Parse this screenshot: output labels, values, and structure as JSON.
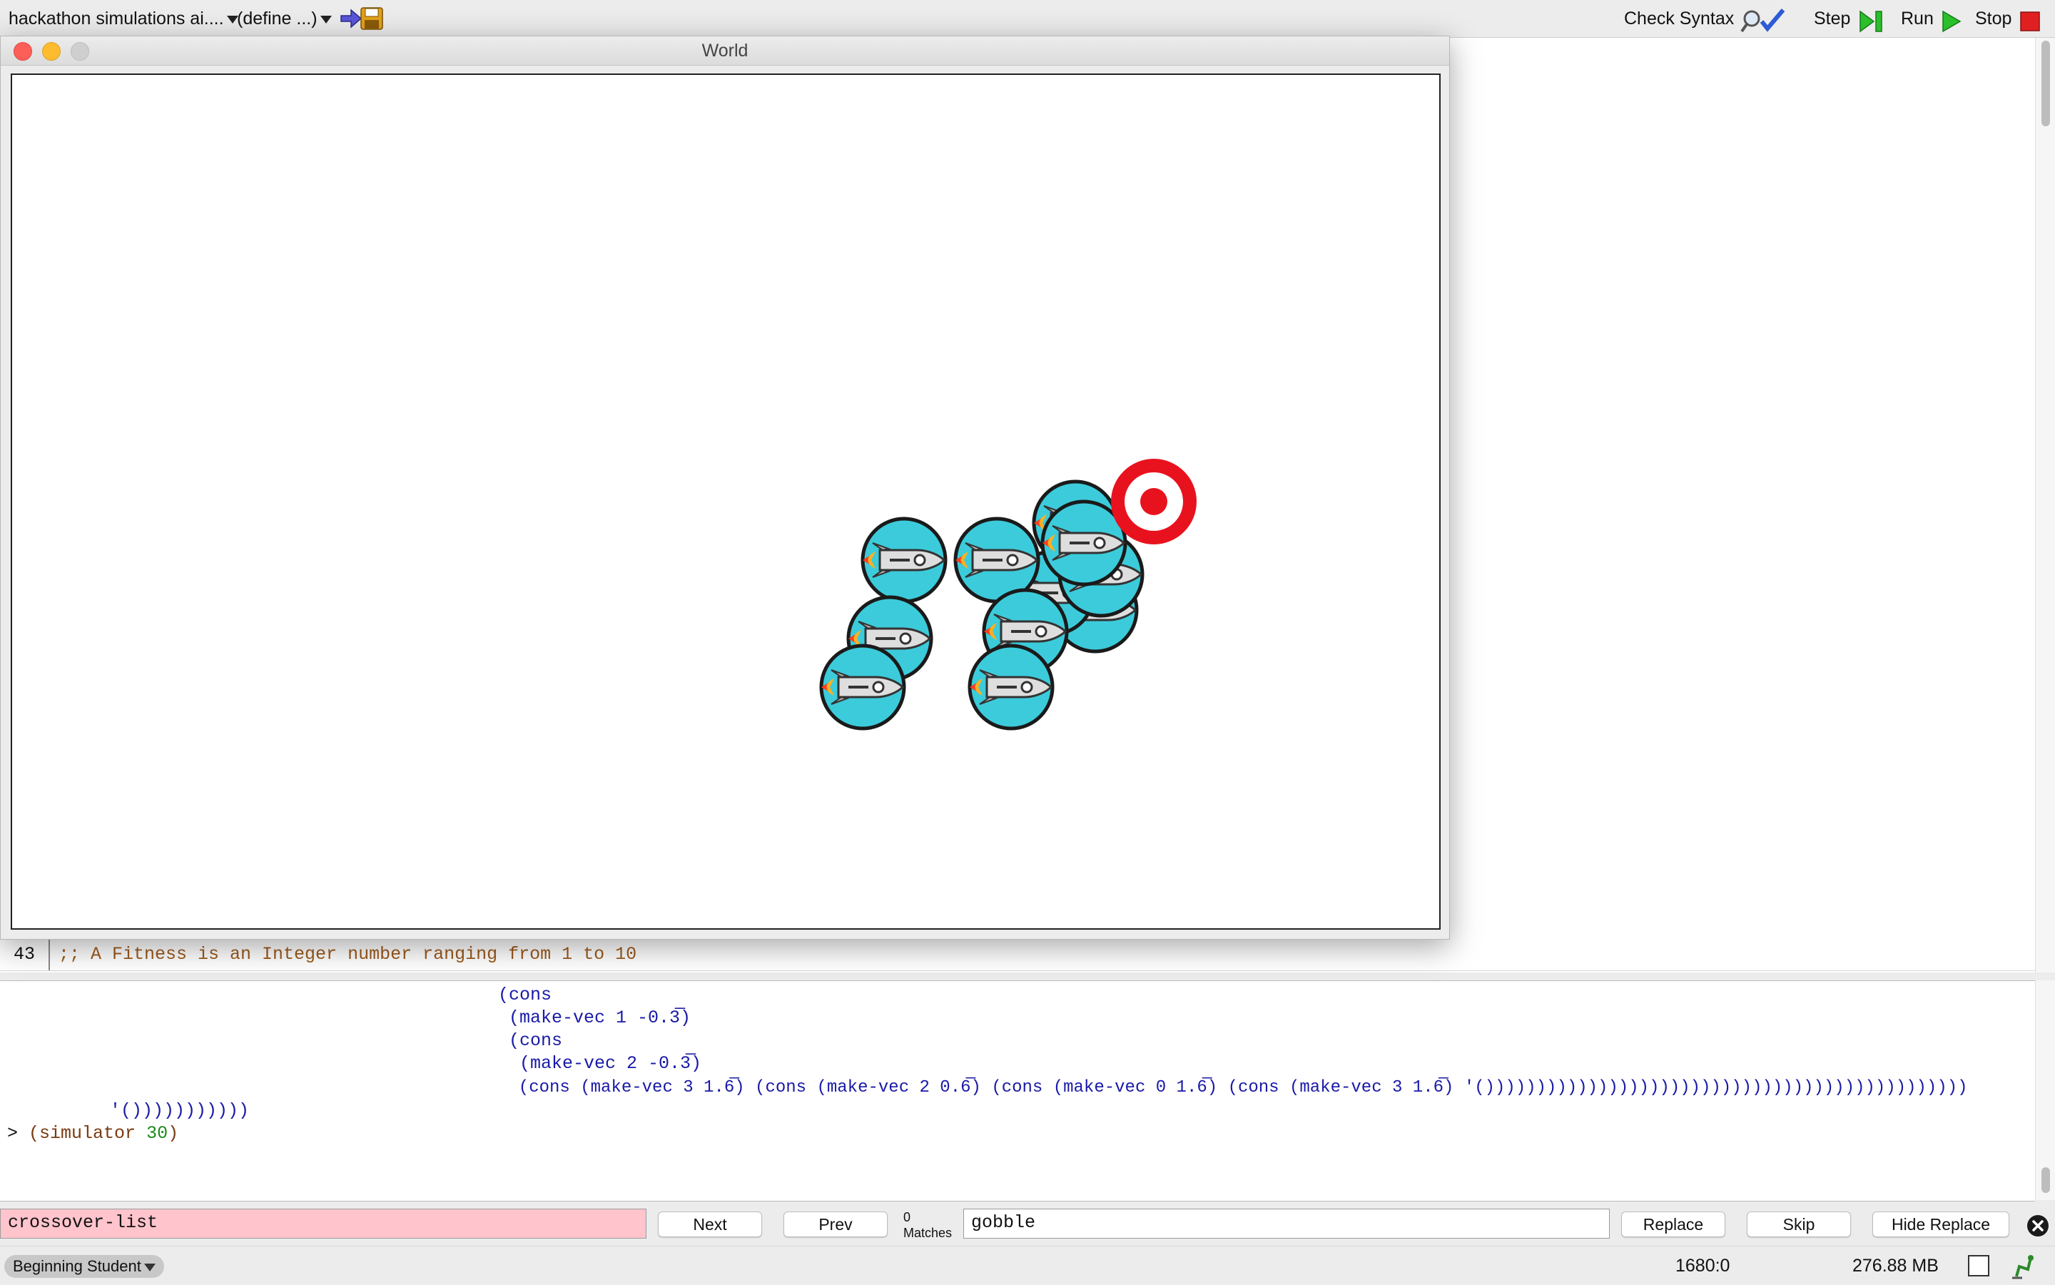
{
  "toolbar": {
    "file_name": "hackathon simulations ai....",
    "define_menu": "(define ...)",
    "check_syntax": "Check Syntax",
    "step": "Step",
    "run": "Run",
    "stop": "Stop"
  },
  "world_window": {
    "title": "World"
  },
  "editor": {
    "line_number": "43",
    "comment": ";; A Fitness is an Integer number ranging from 1 to 10"
  },
  "repl": {
    "lines": [
      "(cons",
      " (make-vec 1 -0.3̅)",
      " (cons",
      "  (make-vec 2 -0.3̅)",
      "  (cons (make-vec 3 1.6̅) (cons (make-vec 2 0.6̅) (cons (make-vec 0 1.6̅) (cons (make-vec 3 1.6̅) '()))))))))))))))))))))))))))))))))))))))))))))))",
      "'()))))))))))"
    ],
    "prompt": ">",
    "command_prefix": "(simulator ",
    "command_arg": "30",
    "command_suffix": ")"
  },
  "find": {
    "search_value": "crossover-list",
    "next_label": "Next",
    "prev_label": "Prev",
    "match_count": "0",
    "matches_label": "Matches",
    "replace_value": "gobble",
    "replace_label": "Replace",
    "skip_label": "Skip",
    "hide_replace_label": "Hide Replace"
  },
  "status": {
    "language": "Beginning Student",
    "position": "1680:0",
    "memory": "276.88 MB"
  },
  "colors": {
    "rocket_bubble": "#3ccbdb",
    "target_red": "#e8121e",
    "find_field_bg": "#ffc4cc",
    "run_green": "#2bbf2b",
    "stop_red": "#e02020"
  }
}
